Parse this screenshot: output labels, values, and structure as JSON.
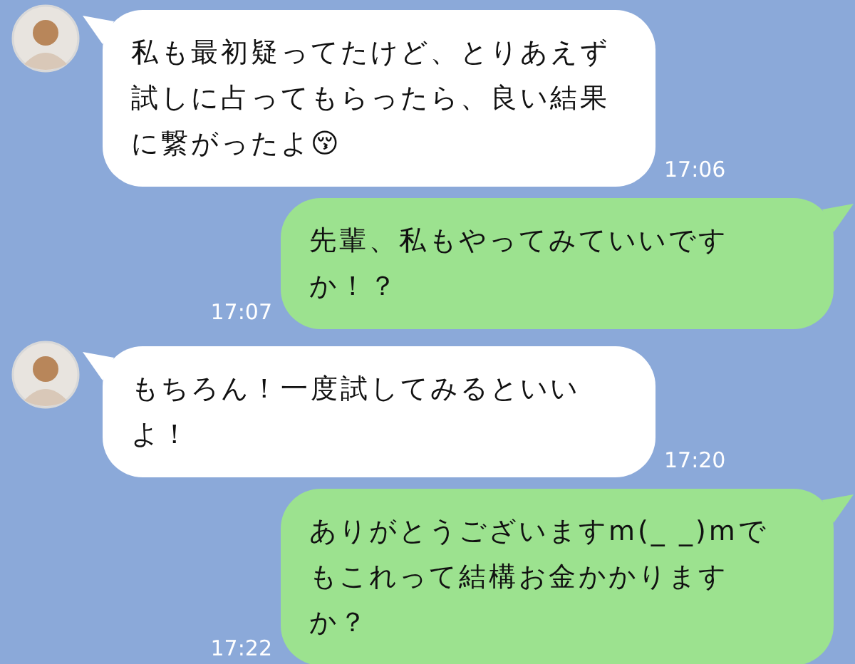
{
  "messages": [
    {
      "kind": "incoming",
      "text": "私も最初疑ってたけど、とりあえず試しに占ってもらったら、良い結果に繋がったよ😚",
      "time": "17:06"
    },
    {
      "kind": "outgoing",
      "text": "先輩、私もやってみていいですか！？",
      "time": "17:07"
    },
    {
      "kind": "incoming",
      "text": "もちろん！一度試してみるといいよ！",
      "time": "17:20"
    },
    {
      "kind": "outgoing",
      "text": "ありがとうございますm(_ _)mでもこれって結構お金かかりますか？",
      "time": "17:22"
    }
  ]
}
